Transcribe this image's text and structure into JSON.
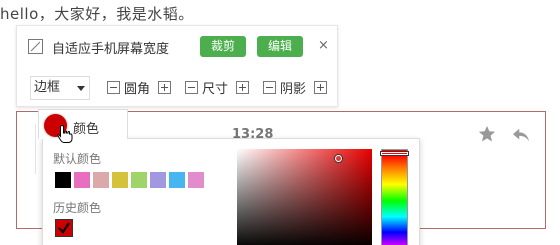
{
  "intro_text": "hello，大家好，我是水韬。",
  "toolbar": {
    "autosize_label": "自适应手机屏幕宽度",
    "crop_label": "裁剪",
    "edit_label": "编辑",
    "close_label": "×",
    "border_select_value": "边框",
    "steppers": [
      {
        "label": "圆角"
      },
      {
        "label": "尺寸"
      },
      {
        "label": "阴影"
      }
    ]
  },
  "color_button": {
    "label": "颜色",
    "current_color": "#cc0000"
  },
  "picker": {
    "default_header": "默认颜色",
    "history_header": "历史颜色",
    "default_swatches": [
      "#000000",
      "#e86fc0",
      "#dba9a9",
      "#d4c23a",
      "#9fd46a",
      "#a199e0",
      "#47b5f0",
      "#e28ccc"
    ],
    "history_swatches": [
      "#cc0000"
    ]
  },
  "message": {
    "time": "13:28"
  },
  "colors": {
    "accent_green": "#4cae4c",
    "block_border": "#b56a6a"
  }
}
